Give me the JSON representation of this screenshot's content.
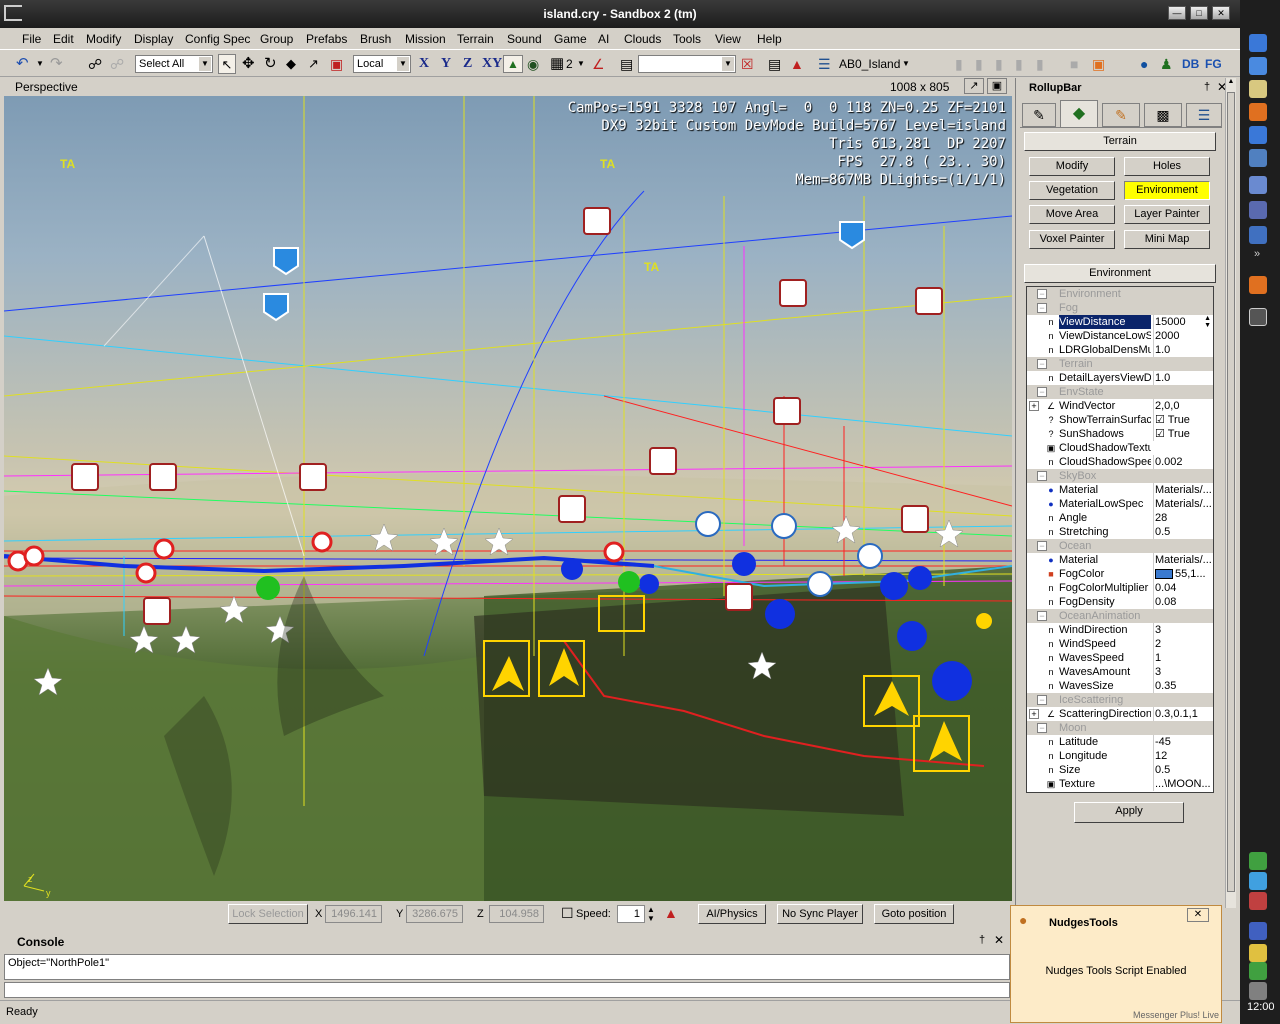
{
  "window": {
    "title": "island.cry - Sandbox 2 (tm)"
  },
  "menu": [
    "File",
    "Edit",
    "Modify",
    "Display",
    "Config Spec",
    "Group",
    "Prefabs",
    "Brush",
    "Mission",
    "Terrain",
    "Sound",
    "Game",
    "AI",
    "Clouds",
    "Tools",
    "View",
    "Help"
  ],
  "toolbar": {
    "select_all": "Select All",
    "coord_system": "Local",
    "axis_x": "X",
    "axis_y": "Y",
    "axis_z": "Z",
    "axis_xy": "XY",
    "grid_value": "2",
    "layer": "AB0_Island",
    "icon_db": "DB",
    "icon_fg": "FG"
  },
  "viewport": {
    "name": "Perspective",
    "resolution": "1008 x 805",
    "hud": [
      "CamPos=1591 3328 107 Angl=  0  0 118 ZN=0.25 ZF=2101",
      "DX9 32bit Custom DevMode Build=5767 Level=island",
      "Tris 613,281  DP 2207",
      "FPS  27.8 ( 23.. 30)",
      "Mem=867MB DLights=(1/1/1)"
    ],
    "axis_labels": {
      "z": "z",
      "y": "y"
    }
  },
  "statusbar": {
    "lock_selection": "Lock Selection",
    "x_label": "X",
    "x_value": "1496.141",
    "y_label": "Y",
    "y_value": "3286.675",
    "z_label": "Z",
    "z_value": "104.958",
    "speed_label": "Speed:",
    "speed_value": "1",
    "ai_physics": "AI/Physics",
    "no_sync_player": "No Sync Player",
    "goto_position": "Goto position"
  },
  "console": {
    "title": "Console",
    "output": "Object=\"NorthPole1\""
  },
  "ready": "Ready",
  "rollup": {
    "title": "RollupBar",
    "terrain_header": "Terrain",
    "buttons": [
      {
        "label": "Modify",
        "active": false
      },
      {
        "label": "Holes",
        "active": false
      },
      {
        "label": "Vegetation",
        "active": false
      },
      {
        "label": "Environment",
        "active": true
      },
      {
        "label": "Move Area",
        "active": false
      },
      {
        "label": "Layer Painter",
        "active": false
      },
      {
        "label": "Voxel Painter",
        "active": false
      },
      {
        "label": "Mini Map",
        "active": false
      }
    ],
    "env_header": "Environment",
    "apply": "Apply",
    "active_color": "#ffff00",
    "properties": [
      {
        "type": "cat",
        "name": "Environment"
      },
      {
        "type": "cat",
        "name": "Fog"
      },
      {
        "type": "prop",
        "icon": "n",
        "name": "ViewDistance",
        "value": "15000",
        "selected": true
      },
      {
        "type": "prop",
        "icon": "n",
        "name": "ViewDistanceLowS",
        "value": "2000"
      },
      {
        "type": "prop",
        "icon": "n",
        "name": "LDRGlobalDensMul",
        "value": "1.0"
      },
      {
        "type": "cat",
        "name": "Terrain"
      },
      {
        "type": "prop",
        "icon": "n",
        "name": "DetailLayersViewD",
        "value": "1.0"
      },
      {
        "type": "cat",
        "name": "EnvState"
      },
      {
        "type": "prop",
        "icon": "vec",
        "name": "WindVector",
        "value": "2,0,0",
        "expand": true
      },
      {
        "type": "prop",
        "icon": "?",
        "name": "ShowTerrainSurfac",
        "value": "True",
        "check": true
      },
      {
        "type": "prop",
        "icon": "?",
        "name": "SunShadows",
        "value": "True",
        "check": true
      },
      {
        "type": "prop",
        "icon": "tex",
        "name": "CloudShadowTextu",
        "value": ""
      },
      {
        "type": "prop",
        "icon": "n",
        "name": "CloudShadowSpee",
        "value": "0.002"
      },
      {
        "type": "cat",
        "name": "SkyBox"
      },
      {
        "type": "prop",
        "icon": "mat",
        "name": "Material",
        "value": "Materials/..."
      },
      {
        "type": "prop",
        "icon": "mat",
        "name": "MaterialLowSpec",
        "value": "Materials/..."
      },
      {
        "type": "prop",
        "icon": "n",
        "name": "Angle",
        "value": "28"
      },
      {
        "type": "prop",
        "icon": "n",
        "name": "Stretching",
        "value": "0.5"
      },
      {
        "type": "cat",
        "name": "Ocean"
      },
      {
        "type": "prop",
        "icon": "mat",
        "name": "Material",
        "value": "Materials/..."
      },
      {
        "type": "prop",
        "icon": "col",
        "name": "FogColor",
        "value": "55,1...",
        "swatch": "#3a7ad0"
      },
      {
        "type": "prop",
        "icon": "n",
        "name": "FogColorMultiplier",
        "value": "0.04"
      },
      {
        "type": "prop",
        "icon": "n",
        "name": "FogDensity",
        "value": "0.08"
      },
      {
        "type": "cat",
        "name": "OceanAnimation"
      },
      {
        "type": "prop",
        "icon": "n",
        "name": "WindDirection",
        "value": "3"
      },
      {
        "type": "prop",
        "icon": "n",
        "name": "WindSpeed",
        "value": "2"
      },
      {
        "type": "prop",
        "icon": "n",
        "name": "WavesSpeed",
        "value": "1"
      },
      {
        "type": "prop",
        "icon": "n",
        "name": "WavesAmount",
        "value": "3"
      },
      {
        "type": "prop",
        "icon": "n",
        "name": "WavesSize",
        "value": "0.35"
      },
      {
        "type": "cat",
        "name": "IceScattering"
      },
      {
        "type": "prop",
        "icon": "vec",
        "name": "ScatteringDirection",
        "value": "0.3,0.1,1",
        "expand": true
      },
      {
        "type": "cat",
        "name": "Moon"
      },
      {
        "type": "prop",
        "icon": "n",
        "name": "Latitude",
        "value": "-45"
      },
      {
        "type": "prop",
        "icon": "n",
        "name": "Longitude",
        "value": "12"
      },
      {
        "type": "prop",
        "icon": "n",
        "name": "Size",
        "value": "0.5"
      },
      {
        "type": "prop",
        "icon": "tex",
        "name": "Texture",
        "value": "...\\MOON..."
      }
    ]
  },
  "nudges": {
    "title": "NudgesTools",
    "message": "Nudges Tools Script Enabled",
    "footer": "Messenger Plus! Live"
  },
  "taskbar": {
    "clock": "12:00"
  }
}
